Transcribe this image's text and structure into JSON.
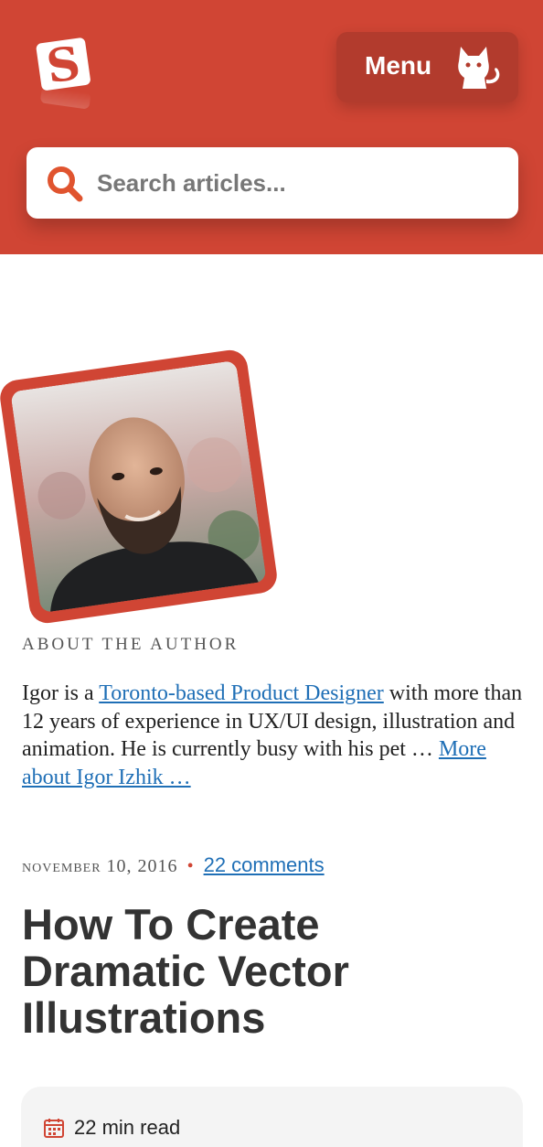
{
  "header": {
    "logo_letter": "S",
    "menu_label": "Menu",
    "search_placeholder": "Search articles..."
  },
  "author": {
    "about_label": "ABOUT THE AUTHOR",
    "bio_prefix": "Igor is a ",
    "bio_link": "Toronto-based Product Designer",
    "bio_middle": " with more than 12 years of experience in UX/UI design, illustration and animation. He is currently busy with his pet … ",
    "more_link": "More about Igor Izhik …"
  },
  "article": {
    "date": "November 10, 2016",
    "separator": "•",
    "comments": "22 comments",
    "title": "How To Create Dramatic Vector Illustrations",
    "read_time": "22 min read"
  },
  "colors": {
    "brand": "#d04534",
    "link": "#1f6fb6"
  },
  "icons": [
    "smashing-logo-icon",
    "cat-mascot-icon",
    "search-icon",
    "calendar-icon",
    "author-photo"
  ]
}
